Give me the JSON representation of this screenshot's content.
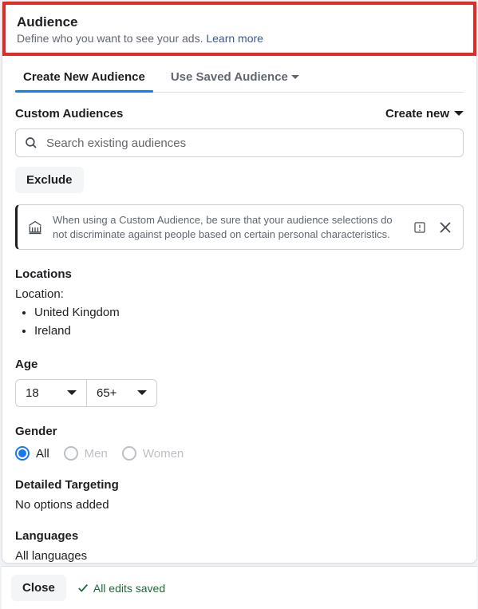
{
  "header": {
    "title": "Audience",
    "desc": "Define who you want to see your ads. ",
    "learn_more": "Learn more"
  },
  "tabs": {
    "create": "Create New Audience",
    "saved": "Use Saved Audience"
  },
  "custom": {
    "label": "Custom Audiences",
    "create_new": "Create new",
    "search_placeholder": "Search existing audiences",
    "exclude": "Exclude",
    "info": "When using a Custom Audience, be sure that your audience selections do not discriminate against people based on certain personal characteristics."
  },
  "locations": {
    "label": "Locations",
    "sub": "Location:",
    "items": [
      "United Kingdom",
      "Ireland"
    ]
  },
  "age": {
    "label": "Age",
    "min": "18",
    "max": "65+"
  },
  "gender": {
    "label": "Gender",
    "options": {
      "all": "All",
      "men": "Men",
      "women": "Women"
    }
  },
  "targeting": {
    "label": "Detailed Targeting",
    "value": "No options added"
  },
  "languages": {
    "label": "Languages",
    "value": "All languages"
  },
  "footer": {
    "close": "Close",
    "saved": "All edits saved"
  }
}
